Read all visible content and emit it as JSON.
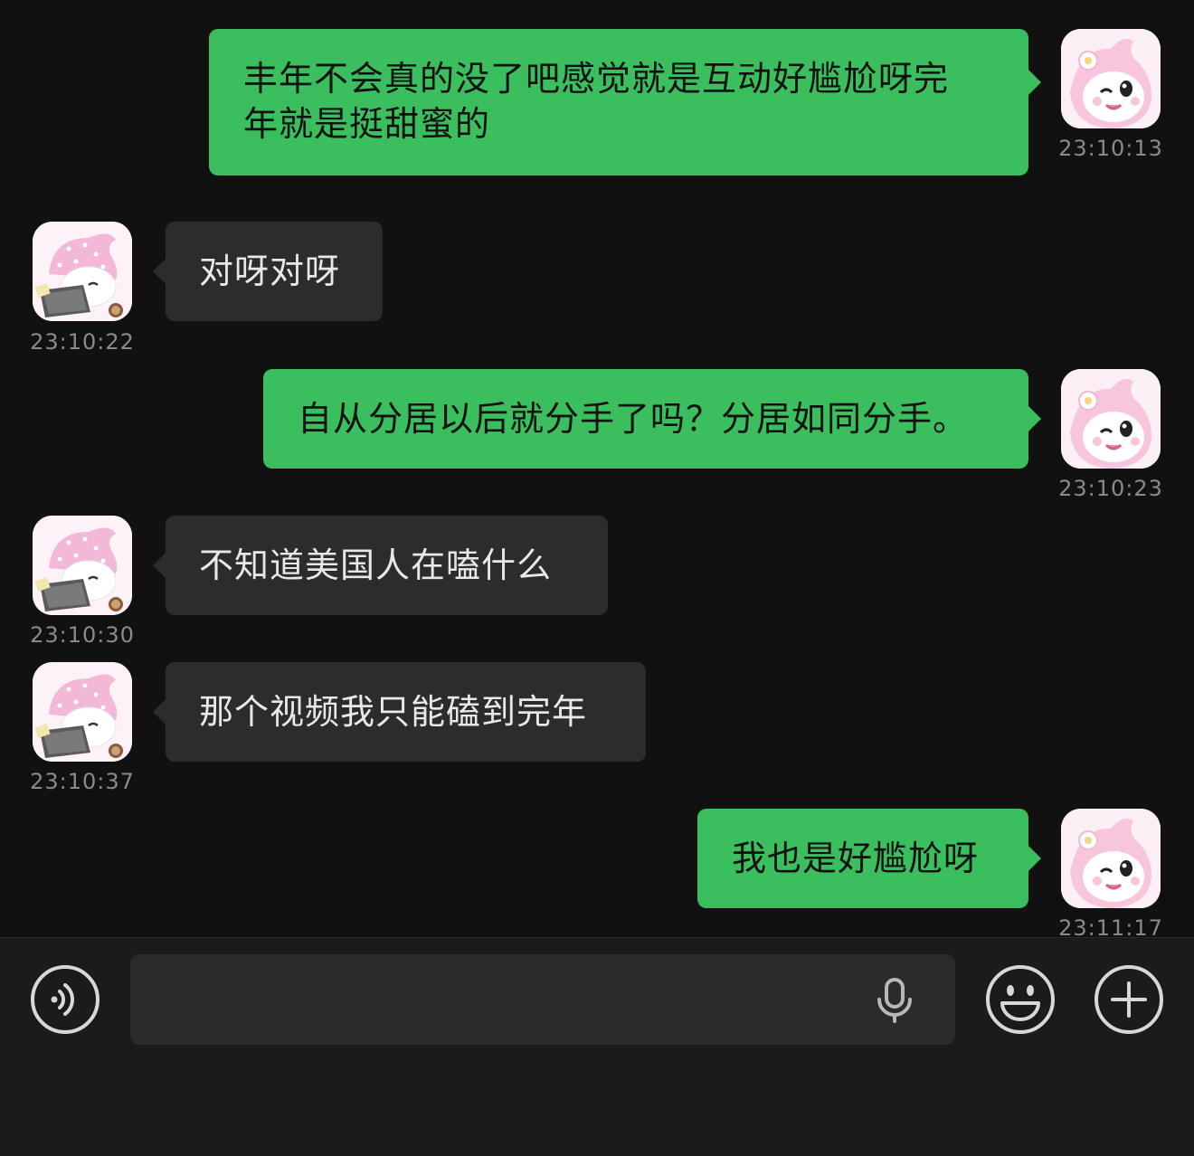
{
  "messages": [
    {
      "side": "me",
      "text": "丰年不会真的没了吧感觉就是互动好尴尬呀完年就是挺甜蜜的",
      "line1": "丰年不会真的没了吧感觉就是互动好尴尬呀完",
      "line2": "年就是挺甜蜜的",
      "time": "23:10:13"
    },
    {
      "side": "them",
      "text": "对呀对呀",
      "time": "23:10:22"
    },
    {
      "side": "me",
      "text": "自从分居以后就分手了吗？分居如同分手。",
      "time": "23:10:23"
    },
    {
      "side": "them",
      "text": "不知道美国人在嗑什么",
      "time": "23:10:30"
    },
    {
      "side": "them",
      "text": "那个视频我只能磕到完年",
      "time": "23:10:37"
    },
    {
      "side": "me",
      "text": "我也是好尴尬呀",
      "time": "23:11:17"
    }
  ],
  "input": {
    "placeholder": ""
  },
  "icons": {
    "voice": "voice-toggle-icon",
    "mic": "microphone-icon",
    "emoji": "emoji-icon",
    "plus": "plus-icon"
  },
  "colors": {
    "background": "#111111",
    "my_bubble": "#3bbf5e",
    "their_bubble": "#2c2c2c",
    "timestamp": "#8a8a8a",
    "input_bar": "#1b1b1b"
  }
}
